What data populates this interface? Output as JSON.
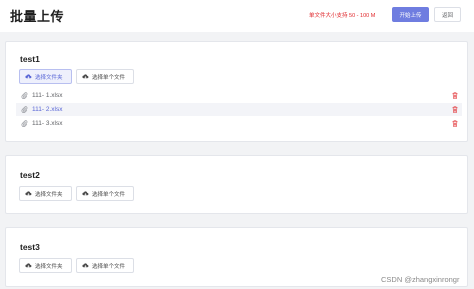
{
  "header": {
    "title": "批量上传",
    "size_hint": "单文件大小支持 50 - 100 M",
    "start_label": "开始上传",
    "back_label": "返回"
  },
  "cards": [
    {
      "title": "test1",
      "folder_label": "选择文件夹",
      "file_label": "选择单个文件",
      "files": [
        {
          "name": "111- 1.xlsx"
        },
        {
          "name": "111- 2.xlsx"
        },
        {
          "name": "111- 3.xlsx"
        }
      ]
    },
    {
      "title": "test2",
      "folder_label": "选择文件夹",
      "file_label": "选择单个文件",
      "files": []
    },
    {
      "title": "test3",
      "folder_label": "选择文件夹",
      "file_label": "选择单个文件",
      "files": []
    }
  ],
  "watermark": "CSDN @zhangxinrongr",
  "colors": {
    "accent": "#6f7de0",
    "danger": "#e0262a",
    "page_bg": "#f2f3f5"
  },
  "icons": {
    "upload": "cloud-upload-icon",
    "attachment": "paperclip-icon",
    "delete": "trash-icon"
  }
}
